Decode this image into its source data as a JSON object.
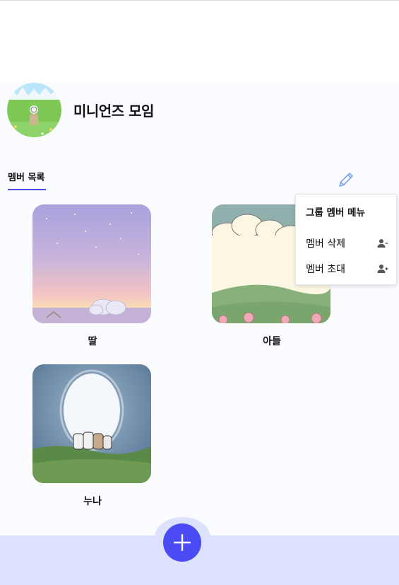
{
  "group": {
    "name": "미니언즈 모임"
  },
  "tabs": [
    {
      "label": "멤버 목록"
    }
  ],
  "members": [
    {
      "name": "딸"
    },
    {
      "name": "아들"
    },
    {
      "name": "누나"
    }
  ],
  "member_menu": {
    "title": "그룹 멤버 메뉴",
    "items": [
      {
        "label": "멤버 삭제",
        "icon": "person-remove-icon"
      },
      {
        "label": "멤버 초대",
        "icon": "person-add-icon"
      }
    ]
  },
  "colors": {
    "accent": "#4b4bf2",
    "bottom_bar": "#dde2ff"
  }
}
